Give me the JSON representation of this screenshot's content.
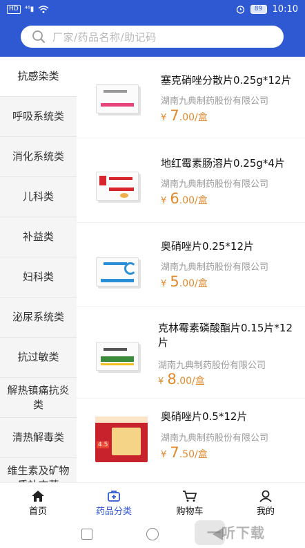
{
  "status_bar": {
    "left": "HD ⁴⁶",
    "battery": "89",
    "time": "10:10"
  },
  "search": {
    "placeholder": "厂家/药品名称/助记码"
  },
  "sidebar": {
    "items": [
      {
        "label": "抗感染类",
        "active": true
      },
      {
        "label": "呼吸系统类"
      },
      {
        "label": "消化系统类"
      },
      {
        "label": "儿科类"
      },
      {
        "label": "补益类"
      },
      {
        "label": "妇科类"
      },
      {
        "label": "泌尿系统类"
      },
      {
        "label": "抗过敏类"
      },
      {
        "label": "解热镇痛抗炎类"
      },
      {
        "label": "清热解毒类"
      },
      {
        "label": "维生素及矿物质补充药"
      }
    ]
  },
  "products": [
    {
      "name": "塞克硝唑分散片0.25g*12片",
      "maker": "湖南九典制药股份有限公司",
      "currency": "¥",
      "price_int": "7",
      "price_dec": ".00",
      "unit": "/盒",
      "accent": "#e6457a"
    },
    {
      "name": "地红霉素肠溶片0.25g*4片",
      "maker": "湖南九典制药股份有限公司",
      "currency": "¥",
      "price_int": "6",
      "price_dec": ".00",
      "unit": "/盒",
      "accent": "#d8252d"
    },
    {
      "name": "奥硝唑片0.25*12片",
      "maker": "湖南九典制药股份有限公司",
      "currency": "¥",
      "price_int": "5",
      "price_dec": ".00",
      "unit": "/盒",
      "accent": "#2a8fd6"
    },
    {
      "name": "克林霉素磷酸酯片0.15片*12片",
      "maker": "湖南九典制药股份有限公司",
      "currency": "¥",
      "price_int": "8",
      "price_dec": ".00",
      "unit": "/盒",
      "accent": "#3c8a3c"
    },
    {
      "name": "奥硝唑片0.5*12片",
      "maker": "湖南九典制药股份有限公司",
      "currency": "¥",
      "price_int": "7",
      "price_dec": ".50",
      "unit": "/盒",
      "accent": "#c8232c",
      "image_badge": "4.5"
    }
  ],
  "tabbar": {
    "tabs": [
      {
        "label": "首页",
        "icon": "home-icon"
      },
      {
        "label": "药品分类",
        "icon": "medicine-box-icon",
        "active": true
      },
      {
        "label": "购物车",
        "icon": "cart-icon"
      },
      {
        "label": "我的",
        "icon": "user-icon"
      }
    ]
  },
  "watermark": {
    "text": "一听下载"
  },
  "colors": {
    "brand_blue": "#2f58d3",
    "price_orange": "#e0892c",
    "sidebar_bg": "#f5f5f5"
  }
}
